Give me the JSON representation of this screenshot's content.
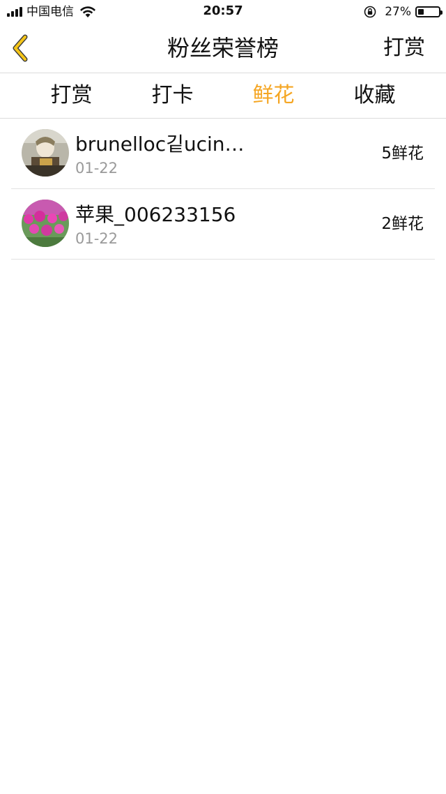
{
  "status_bar": {
    "carrier": "中国电信",
    "time": "20:57",
    "battery_percent": "27%",
    "battery_level": 0.27
  },
  "header": {
    "title": "粉丝荣誉榜",
    "action_label": "打赏",
    "back_icon": "chevron-left-icon",
    "back_icon_color": "#F5C518"
  },
  "tabs": [
    {
      "label": "打赏",
      "active": false
    },
    {
      "label": "打卡",
      "active": false
    },
    {
      "label": "鲜花",
      "active": true
    },
    {
      "label": "收藏",
      "active": false
    }
  ],
  "accent_color": "#F5A623",
  "fans": [
    {
      "name": "brunelloc깉ucin…",
      "date": "01-22",
      "amount": "5鲜花"
    },
    {
      "name": "苹果_006233156",
      "date": "01-22",
      "amount": "2鲜花"
    }
  ]
}
